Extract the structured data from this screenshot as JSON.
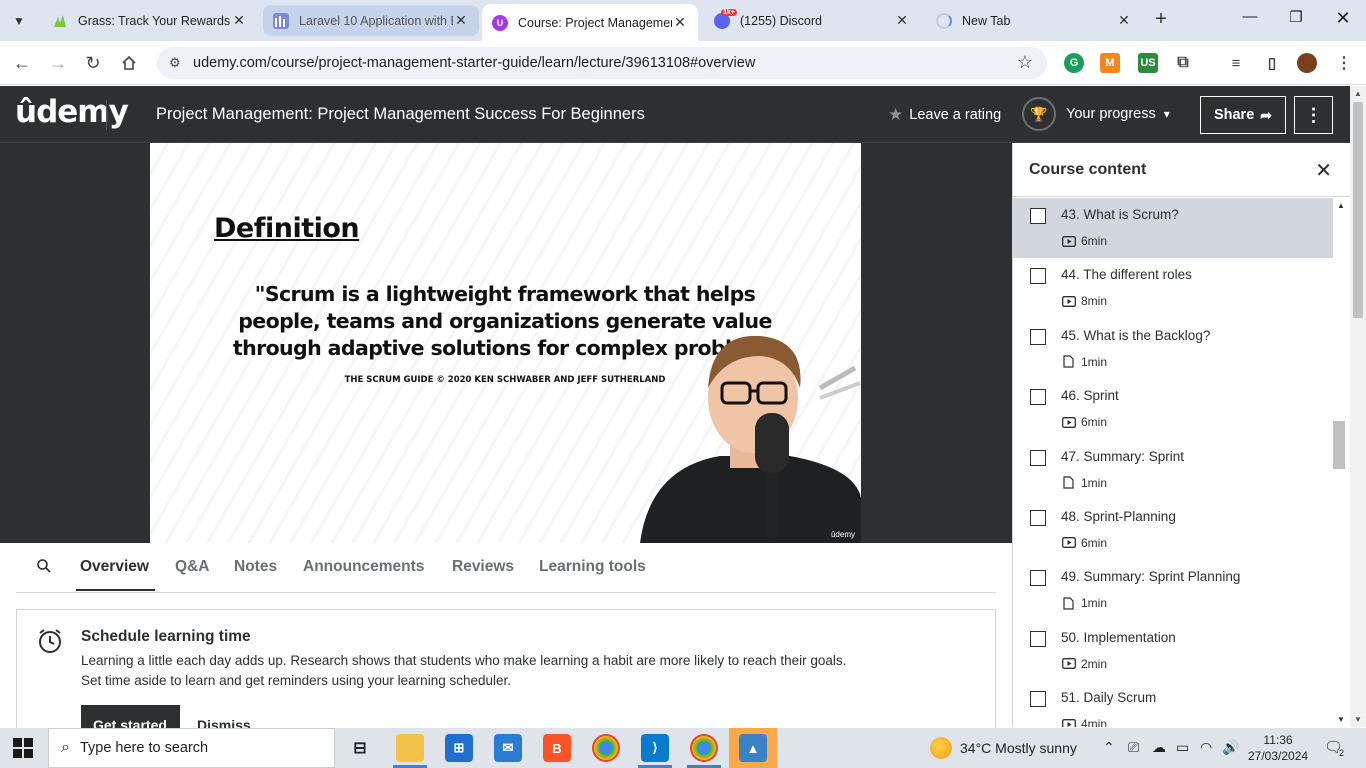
{
  "browser": {
    "tabs": [
      {
        "title": "Grass: Track Your Rewards",
        "icon": "grass-icon",
        "color": "#7ac943"
      },
      {
        "title": "Laravel 10 Application with E",
        "icon": "laravel-icon",
        "color": "#7b8bd4"
      },
      {
        "title": "Course: Project Managemen",
        "icon": "udemy-icon",
        "color": "#a435f0"
      },
      {
        "title": "(1255) Discord",
        "icon": "discord-icon",
        "color": "#5865f2",
        "badge": "1k+"
      },
      {
        "title": "New Tab",
        "icon": "loading-icon",
        "color": "#cccccc"
      }
    ],
    "url": "udemy.com/course/project-management-starter-guide/learn/lecture/39613108#overview"
  },
  "header": {
    "logo": "ûdemy",
    "course_title": "Project Management: Project Management Success For Beginners",
    "rate_label": "Leave a rating",
    "progress_label": "Your progress",
    "share_label": "Share",
    "accent": "#a435f0"
  },
  "slide": {
    "heading": "Definition",
    "quote_lines": [
      "\"Scrum is a lightweight framework that helps",
      "people, teams and organizations generate value",
      "through adaptive solutions for complex problems"
    ],
    "citation": "THE SCRUM GUIDE © 2020 KEN SCHWABER AND JEFF SUTHERLAND",
    "watermark": "ûdemy"
  },
  "lecture_tabs": [
    "Overview",
    "Q&A",
    "Notes",
    "Announcements",
    "Reviews",
    "Learning tools"
  ],
  "schedule": {
    "title": "Schedule learning time",
    "text_line1": "Learning a little each day adds up. Research shows that students who make learning a habit are more likely to reach their goals.",
    "text_line2": "Set time aside to learn and get reminders using your learning scheduler.",
    "get_started": "Get started",
    "dismiss": "Dismiss"
  },
  "sidebar": {
    "title": "Course content",
    "lectures": [
      {
        "title": "43. What is Scrum?",
        "duration": "6min",
        "type": "video",
        "current": true
      },
      {
        "title": "44. The different roles",
        "duration": "8min",
        "type": "video"
      },
      {
        "title": "45. What is the Backlog?",
        "duration": "1min",
        "type": "article"
      },
      {
        "title": "46. Sprint",
        "duration": "6min",
        "type": "video"
      },
      {
        "title": "47. Summary: Sprint",
        "duration": "1min",
        "type": "article"
      },
      {
        "title": "48. Sprint-Planning",
        "duration": "6min",
        "type": "video"
      },
      {
        "title": "49. Summary: Sprint Planning",
        "duration": "1min",
        "type": "article"
      },
      {
        "title": "50. Implementation",
        "duration": "2min",
        "type": "video"
      },
      {
        "title": "51. Daily Scrum",
        "duration": "4min",
        "type": "video"
      }
    ]
  },
  "taskbar": {
    "search_placeholder": "Type here to search",
    "weather": "34°C  Mostly sunny",
    "time": "11:36",
    "date": "27/03/2024",
    "notifications": "2"
  }
}
